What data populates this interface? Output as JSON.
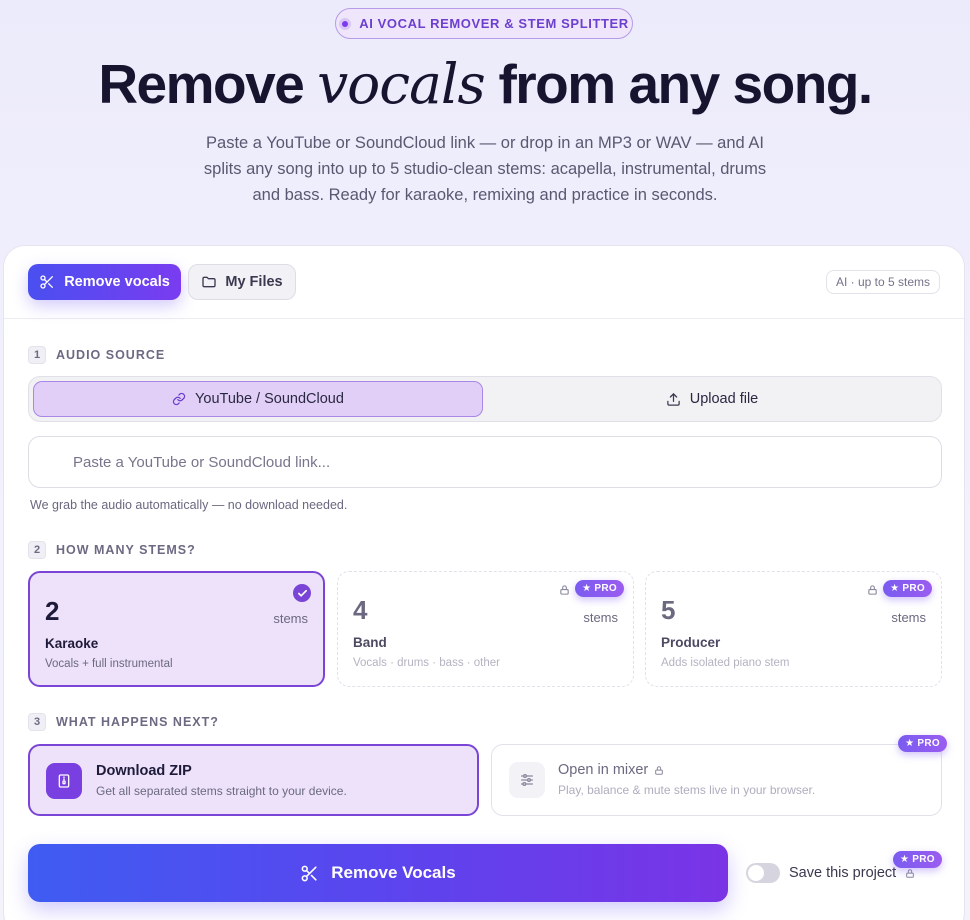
{
  "hero": {
    "badge": "AI VOCAL REMOVER & STEM SPLITTER",
    "headline_a": "Remove",
    "headline_italic": "vocals",
    "headline_b": "from any song.",
    "subtitle": "Paste a YouTube or SoundCloud link — or drop in an MP3 or WAV — and AI splits any song into up to 5 studio-clean stems: acapella, instrumental, drums and bass. Ready for karaoke, remixing and practice in seconds."
  },
  "tabs": {
    "remove_vocals": "Remove vocals",
    "my_files": "My Files",
    "ai_chip": "AI · up to 5 stems"
  },
  "step1": {
    "num": "1",
    "label": "AUDIO SOURCE",
    "opt_link": "YouTube / SoundCloud",
    "opt_upload": "Upload file",
    "input_placeholder": "Paste a YouTube or SoundCloud link...",
    "input_value": "",
    "hint": "We grab the audio automatically — no download needed."
  },
  "step2": {
    "num": "2",
    "label": "HOW MANY STEMS?",
    "unit": "stems",
    "pro": "PRO",
    "options": [
      {
        "count": "2",
        "name": "Karaoke",
        "desc": "Vocals + full instrumental"
      },
      {
        "count": "4",
        "name": "Band",
        "desc": "Vocals · drums · bass · other"
      },
      {
        "count": "5",
        "name": "Producer",
        "desc": "Adds isolated piano stem"
      }
    ]
  },
  "step3": {
    "num": "3",
    "label": "WHAT HAPPENS NEXT?",
    "pro": "PRO",
    "download_title": "Download ZIP",
    "download_desc": "Get all separated stems straight to your device.",
    "mixer_title": "Open in mixer",
    "mixer_desc": "Play, balance & mute stems live in your browser."
  },
  "footer": {
    "cta": "Remove Vocals",
    "save_label": "Save this project",
    "pro": "PRO",
    "save_enabled": false
  },
  "colors": {
    "accent": "#7a45d6",
    "cta_start": "#3f5cf2",
    "cta_end": "#7a34e6"
  }
}
